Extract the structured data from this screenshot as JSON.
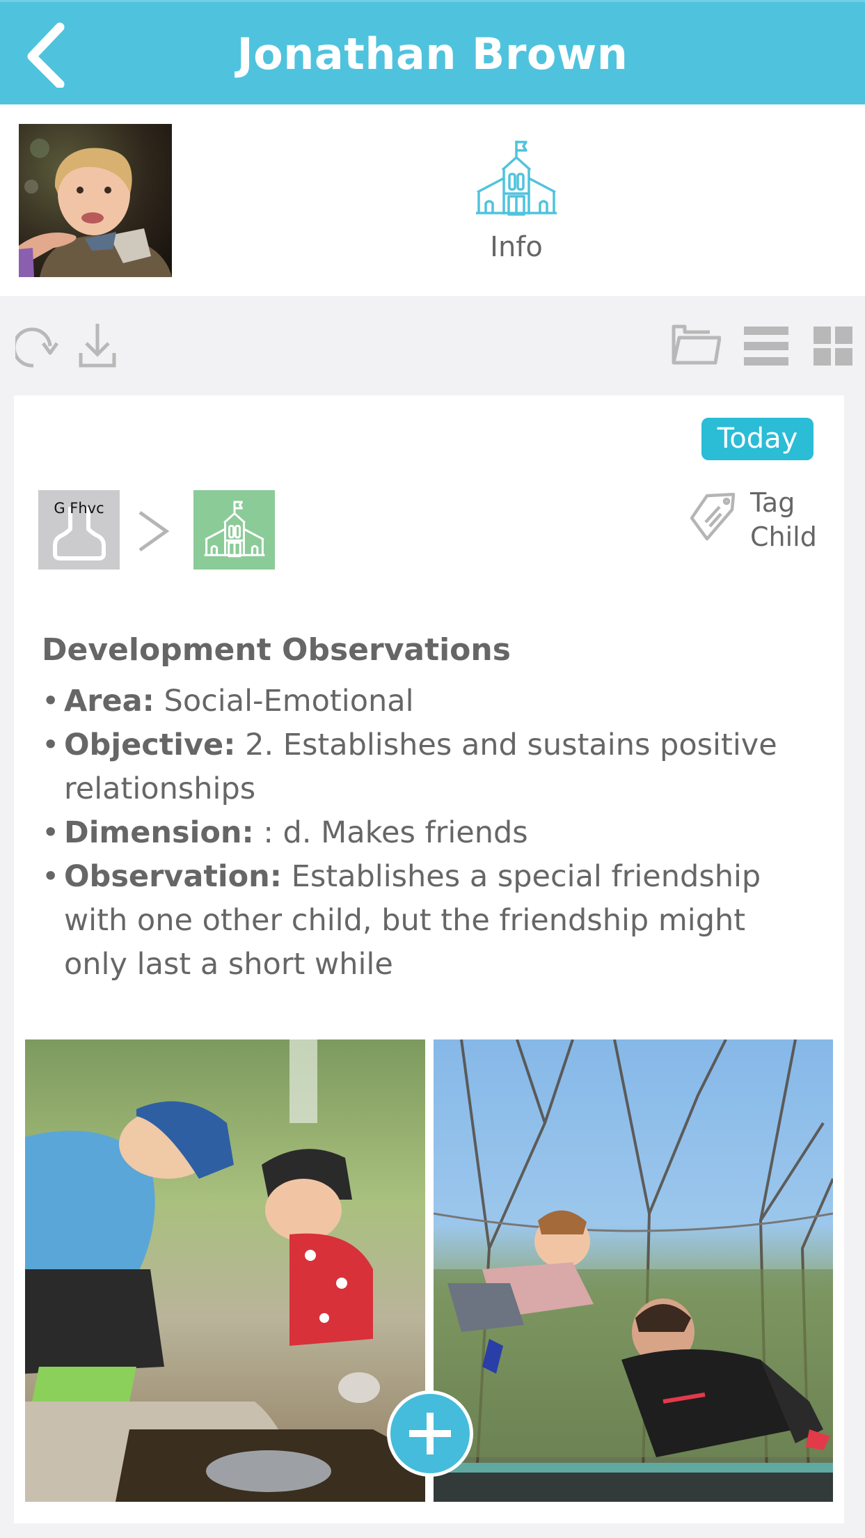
{
  "header": {
    "title": "Jonathan Brown",
    "back_icon": "chevron-left-icon",
    "color": "#4fc3dd"
  },
  "profile": {
    "avatar_alt": "Child profile photo",
    "info_label": "Info",
    "info_icon": "school-icon",
    "accent": "#4fc3dd"
  },
  "toolbar": {
    "left": [
      {
        "icon": "refresh-icon",
        "label": "Refresh"
      },
      {
        "icon": "download-icon",
        "label": "Download"
      }
    ],
    "right": [
      {
        "icon": "folder-icon",
        "label": "Folder"
      },
      {
        "icon": "list-view-icon",
        "label": "List view"
      },
      {
        "icon": "grid-view-icon",
        "label": "Grid view"
      }
    ]
  },
  "post": {
    "date_badge": "Today",
    "badge_color": "#2bbcd6",
    "from": {
      "label": "G Fhvc",
      "icon": "person-icon",
      "color": "#cbcbcd"
    },
    "separator": ">",
    "to": {
      "icon": "school-icon",
      "color": "#8bcb98"
    },
    "tag": {
      "icon": "tag-icon",
      "line1": "Tag",
      "line2": "Child"
    },
    "section_title": "Development Observations",
    "observations": [
      {
        "key": "Area",
        "sep": ":",
        "value": " Social-Emotional"
      },
      {
        "key": "Objective",
        "sep": ":",
        "value": " 2. Establishes and sustains positive relationships"
      },
      {
        "key": "Dimension",
        "sep": ":",
        "value": " : d. Makes friends"
      },
      {
        "key": "Observation",
        "sep": ":",
        "value": " Establishes a special friendship with one other child, but the friendship might only last a short while"
      }
    ],
    "photos": [
      {
        "alt": "Two children playing with water on a rock"
      },
      {
        "alt": "Two children jumping on a trampoline"
      }
    ],
    "add_button": {
      "icon": "plus-icon",
      "label": "Add",
      "color": "#45bcdc"
    }
  }
}
